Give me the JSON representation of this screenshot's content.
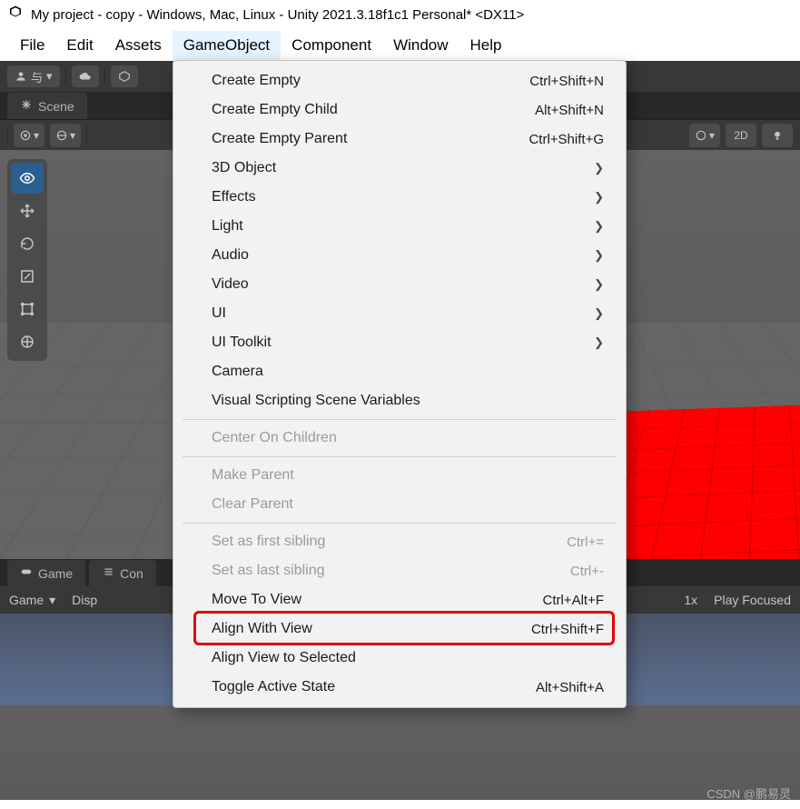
{
  "titlebar": {
    "text": "My project - copy - Windows, Mac, Linux - Unity 2021.3.18f1c1 Personal* <DX11>"
  },
  "menubar": {
    "items": [
      {
        "label": "File"
      },
      {
        "label": "Edit"
      },
      {
        "label": "Assets"
      },
      {
        "label": "GameObject"
      },
      {
        "label": "Component"
      },
      {
        "label": "Window"
      },
      {
        "label": "Help"
      }
    ],
    "active_index": 3
  },
  "toolbar": {
    "account_label": "与",
    "icons": [
      "account-icon",
      "cloud-icon",
      "unity-hub-icon"
    ]
  },
  "scene_tab": {
    "label": "Scene"
  },
  "scene_toolbar": {
    "right_items": [
      "gizmo-dropdown",
      "2d",
      "lighting"
    ],
    "two_d": "2D"
  },
  "gizmo_tools": [
    "view",
    "move",
    "rotate",
    "scale",
    "rect",
    "transform"
  ],
  "game_tabs": {
    "items": [
      {
        "label": "Game",
        "icon": "gamepad-icon"
      },
      {
        "label": "Con",
        "icon": "list-icon"
      }
    ]
  },
  "game_toolbar": {
    "mode": "Game",
    "display": "Disp",
    "scale": "1x",
    "focus": "Play Focused"
  },
  "dropdown": {
    "groups": [
      [
        {
          "label": "Create Empty",
          "shortcut": "Ctrl+Shift+N"
        },
        {
          "label": "Create Empty Child",
          "shortcut": "Alt+Shift+N"
        },
        {
          "label": "Create Empty Parent",
          "shortcut": "Ctrl+Shift+G"
        },
        {
          "label": "3D Object",
          "submenu": true
        },
        {
          "label": "Effects",
          "submenu": true
        },
        {
          "label": "Light",
          "submenu": true
        },
        {
          "label": "Audio",
          "submenu": true
        },
        {
          "label": "Video",
          "submenu": true
        },
        {
          "label": "UI",
          "submenu": true
        },
        {
          "label": "UI Toolkit",
          "submenu": true
        },
        {
          "label": "Camera"
        },
        {
          "label": "Visual Scripting Scene Variables"
        }
      ],
      [
        {
          "label": "Center On Children",
          "disabled": true
        }
      ],
      [
        {
          "label": "Make Parent",
          "disabled": true
        },
        {
          "label": "Clear Parent",
          "disabled": true
        }
      ],
      [
        {
          "label": "Set as first sibling",
          "shortcut": "Ctrl+=",
          "disabled": true
        },
        {
          "label": "Set as last sibling",
          "shortcut": "Ctrl+-",
          "disabled": true
        },
        {
          "label": "Move To View",
          "shortcut": "Ctrl+Alt+F"
        },
        {
          "label": "Align With View",
          "shortcut": "Ctrl+Shift+F",
          "highlight": true
        },
        {
          "label": "Align View to Selected"
        },
        {
          "label": "Toggle Active State",
          "shortcut": "Alt+Shift+A"
        }
      ]
    ]
  },
  "watermark": "CSDN @鹏易灵"
}
